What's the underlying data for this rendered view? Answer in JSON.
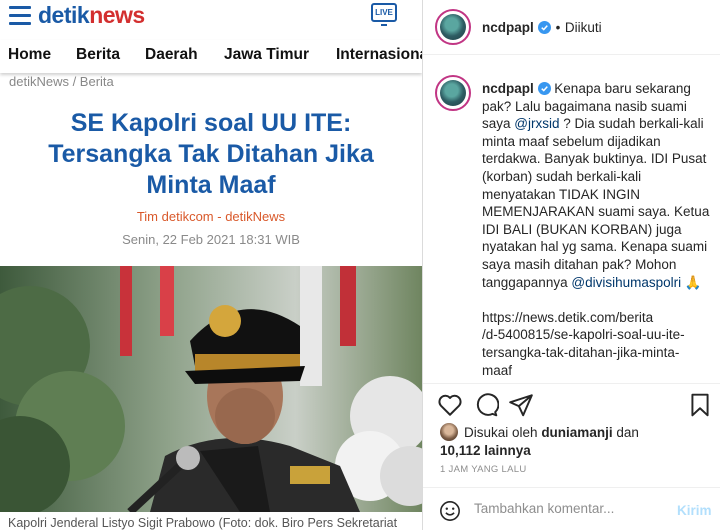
{
  "news": {
    "logo_left": "detik",
    "logo_right": "news",
    "live_label": "LIVE",
    "nav": [
      "Home",
      "Berita",
      "Daerah",
      "Jawa Timur",
      "Internasional"
    ],
    "breadcrumb": "detikNews / Berita",
    "headline_lines": [
      "SE Kapolri soal UU ITE:",
      "Tersangka Tak Ditahan Jika",
      "Minta Maaf"
    ],
    "author": "Tim detikcom - detikNews",
    "date": "Senin, 22 Feb 2021 18:31 WIB",
    "caption": "Kapolri Jenderal Listyo Sigit Prabowo (Foto: dok. Biro Pers Sekretariat"
  },
  "instagram": {
    "username": "ncdpapl",
    "separator": "•",
    "follow_state": "Diikuti",
    "caption_lines": [
      "Kenapa baru sekarang",
      "pak? Lalu bagaimana nasib suami",
      "saya"
    ],
    "mention_1": "@jrxsid",
    "caption_after_mention": "? Dia sudah berkali-kali minta maaf sebelum dijadikan terdakwa. Banyak buktinya. IDI Pusat (korban) sudah berkali-kali menyatakan TIDAK INGIN MEMENJARAKAN suami saya. Ketua IDI BALI (BUKAN KORBAN) juga nyatakan hal yg sama. Kenapa suami saya masih ditahan pak? Mohon tanggapannya",
    "mention_2": "@divisihumaspolri",
    "pray_emoji": "🙏",
    "link_lines": [
      "https://news.detik.com/berita",
      "/d-5400815/se-kapolri-soal-uu-ite-",
      "tersangka-tak-ditahan-jika-minta-",
      "maaf"
    ],
    "liked_by_prefix": "Disukai oleh",
    "liked_by_user": "duniamanji",
    "liked_by_and": "dan",
    "liked_by_count": "10,112 lainnya",
    "time_ago": "1 JAM YANG LALU",
    "comment_placeholder": "Tambahkan komentar...",
    "send_label": "Kirim",
    "colors": {
      "link": "#00376b",
      "verified": "#3897f0",
      "send_disabled": "#b2dffc"
    }
  },
  "colors": {
    "detik_blue": "#1a5aa6",
    "detik_red": "#d32f2f",
    "author_orange": "#d9592b"
  }
}
